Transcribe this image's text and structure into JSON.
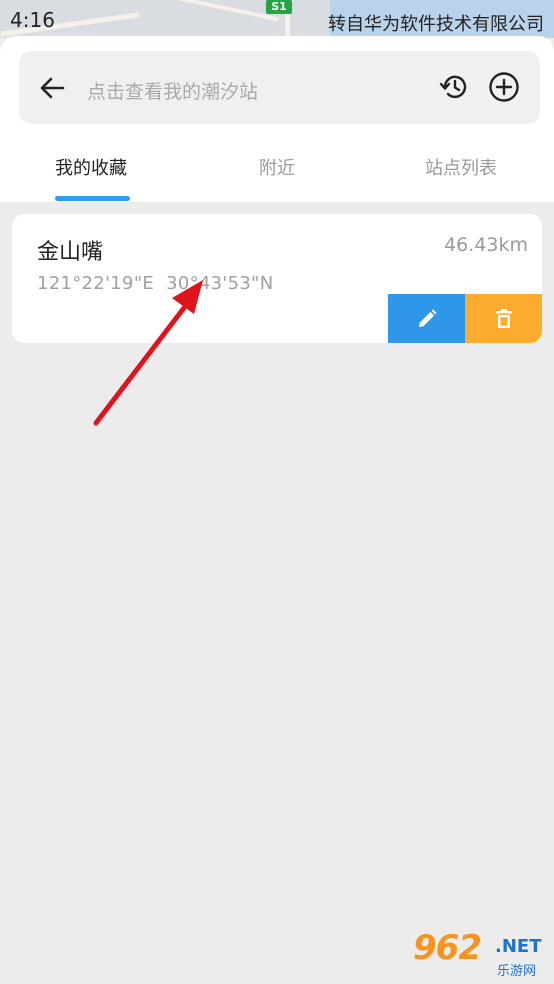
{
  "status_bar": {
    "time": "4:16",
    "source_note": "转自华为软件技术有限公司",
    "map_route_badge": "S1"
  },
  "search": {
    "placeholder": "点击查看我的潮汐站",
    "icons": [
      "back-arrow-icon",
      "history-icon",
      "add-circle-icon"
    ]
  },
  "tabs": [
    {
      "label": "我的收藏",
      "active": true
    },
    {
      "label": "附近",
      "active": false
    },
    {
      "label": "站点列表",
      "active": false
    }
  ],
  "favorites": [
    {
      "name": "金山嘴",
      "distance": "46.43km",
      "longitude": "121°22'19\"E",
      "latitude": "30°43'53\"N",
      "actions": [
        "edit-icon",
        "delete-icon"
      ]
    }
  ],
  "colors": {
    "accent": "#2d9bf0",
    "edit_button": "#2e97ea",
    "delete_button": "#fbac2f",
    "background": "#ececec",
    "annotation_arrow": "#e0121b"
  },
  "watermark": {
    "number": "962",
    "domain": ".NET",
    "sub": "乐游网"
  }
}
